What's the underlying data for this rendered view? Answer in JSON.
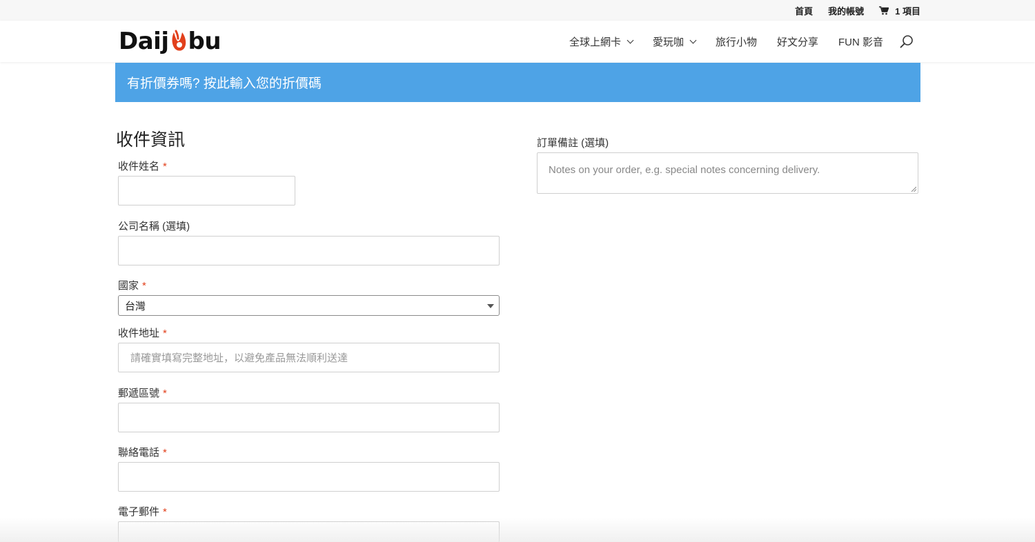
{
  "topbar": {
    "home": "首頁",
    "account": "我的帳號",
    "cart": "1 項目"
  },
  "brand": {
    "logo_left": "Daij",
    "logo_right": "bu",
    "accent": "#e2401c"
  },
  "nav": {
    "items": [
      {
        "label": "全球上網卡",
        "dropdown": true
      },
      {
        "label": "愛玩咖",
        "dropdown": true
      },
      {
        "label": "旅行小物",
        "dropdown": false
      },
      {
        "label": "好文分享",
        "dropdown": false
      },
      {
        "label": "FUN 影音",
        "dropdown": false
      }
    ]
  },
  "coupon": {
    "text": "有折價券嗎? 按此輸入您的折價碼",
    "color": "#4ea3e6"
  },
  "form": {
    "title": "收件資訊",
    "name_label": "收件姓名",
    "company_label": "公司名稱 (選填)",
    "country_label": "國家",
    "country_value": "台灣",
    "address_label": "收件地址",
    "address_placeholder": "請確實填寫完整地址，以避免產品無法順利送達",
    "zip_label": "郵遞區號",
    "phone_label": "聯絡電話",
    "email_label": "電子郵件",
    "required_mark": "*"
  },
  "notes": {
    "label": "訂單備註 (選填)",
    "placeholder": "Notes on your order, e.g. special notes concerning delivery."
  }
}
